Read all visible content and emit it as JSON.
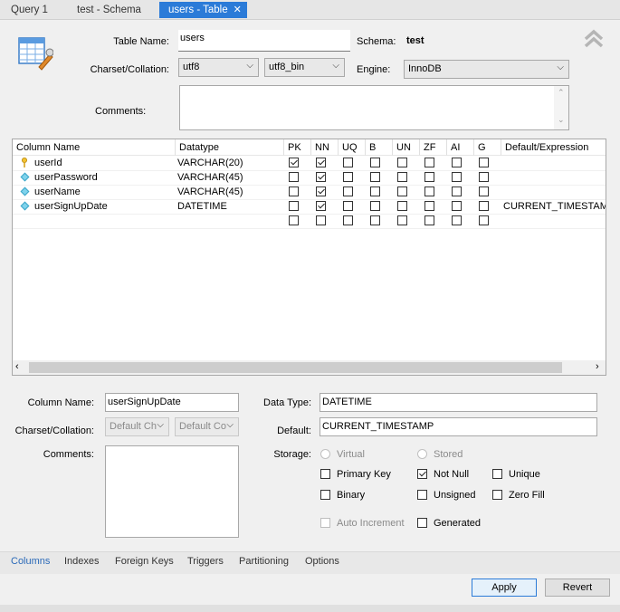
{
  "tabs": [
    {
      "label": "Query 1"
    },
    {
      "label": "test - Schema"
    },
    {
      "label": "users - Table"
    }
  ],
  "form": {
    "table_name_label": "Table Name:",
    "table_name": "users",
    "schema_label": "Schema:",
    "schema": "test",
    "charset_label": "Charset/Collation:",
    "charset": "utf8",
    "collation": "utf8_bin",
    "engine_label": "Engine:",
    "engine": "InnoDB",
    "comments_label": "Comments:"
  },
  "grid": {
    "headers": [
      "Column Name",
      "Datatype",
      "PK",
      "NN",
      "UQ",
      "B",
      "UN",
      "ZF",
      "AI",
      "G",
      "Default/Expression"
    ],
    "rows": [
      {
        "name": "userId",
        "type": "VARCHAR(20)",
        "icon": "key",
        "pk": true,
        "nn": true,
        "default": ""
      },
      {
        "name": "userPassword",
        "type": "VARCHAR(45)",
        "icon": "diamond",
        "pk": false,
        "nn": true,
        "default": ""
      },
      {
        "name": "userName",
        "type": "VARCHAR(45)",
        "icon": "diamond",
        "pk": false,
        "nn": true,
        "default": ""
      },
      {
        "name": "userSignUpDate",
        "type": "DATETIME",
        "icon": "diamond",
        "pk": false,
        "nn": true,
        "default": "CURRENT_TIMESTAMP"
      }
    ]
  },
  "detail": {
    "column_name_label": "Column Name:",
    "column_name": "userSignUpDate",
    "charset_label": "Charset/Collation:",
    "charset": "Default Ch",
    "collation": "Default Co",
    "comments_label": "Comments:",
    "data_type_label": "Data Type:",
    "data_type": "DATETIME",
    "default_label": "Default:",
    "default": "CURRENT_TIMESTAMP",
    "storage_label": "Storage:",
    "virtual": "Virtual",
    "stored": "Stored",
    "primary_key": "Primary Key",
    "not_null": "Not Null",
    "unique": "Unique",
    "binary": "Binary",
    "unsigned": "Unsigned",
    "zero_fill": "Zero Fill",
    "auto_increment": "Auto Increment",
    "generated": "Generated"
  },
  "bottom_tabs": [
    "Columns",
    "Indexes",
    "Foreign Keys",
    "Triggers",
    "Partitioning",
    "Options"
  ],
  "buttons": {
    "apply": "Apply",
    "revert": "Revert"
  }
}
